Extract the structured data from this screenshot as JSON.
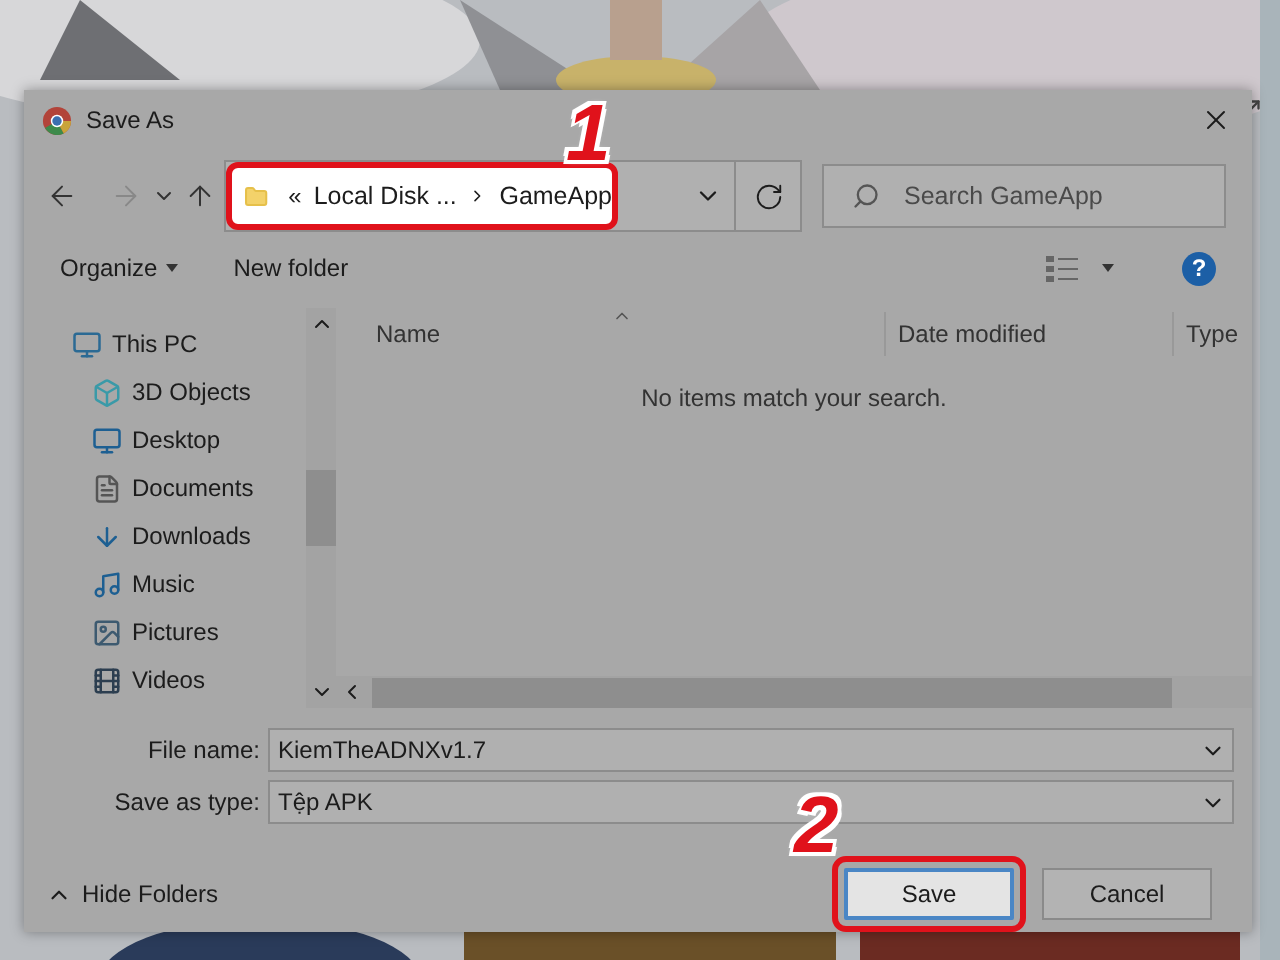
{
  "window": {
    "title": "Save As"
  },
  "address": {
    "overflow": "«",
    "crumbs": [
      "Local Disk ...",
      "GameApp"
    ]
  },
  "search": {
    "placeholder": "Search GameApp"
  },
  "toolbar": {
    "organize": "Organize",
    "new_folder": "New folder",
    "help": "?"
  },
  "nav_pane": {
    "items": [
      {
        "label": "This PC",
        "kind": "pc",
        "children": [
          {
            "label": "3D Objects",
            "kind": "objects"
          },
          {
            "label": "Desktop",
            "kind": "desktop"
          },
          {
            "label": "Documents",
            "kind": "documents"
          },
          {
            "label": "Downloads",
            "kind": "downloads"
          },
          {
            "label": "Music",
            "kind": "music"
          },
          {
            "label": "Pictures",
            "kind": "pictures"
          },
          {
            "label": "Videos",
            "kind": "videos"
          }
        ]
      }
    ]
  },
  "columns": [
    "Name",
    "Date modified",
    "Type"
  ],
  "empty_message": "No items match your search.",
  "file_name": {
    "label": "File name:",
    "value": "KiemTheADNXv1.7"
  },
  "save_type": {
    "label": "Save as type:",
    "value": "Tệp APK"
  },
  "hide_folders": "Hide Folders",
  "buttons": [
    {
      "label": "Save",
      "kind": "primary"
    },
    {
      "label": "Cancel",
      "kind": "secondary"
    }
  ],
  "annotations": [
    {
      "label": "1"
    },
    {
      "label": "2"
    }
  ]
}
